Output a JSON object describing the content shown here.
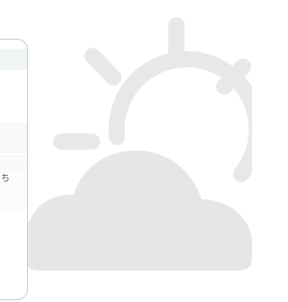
{
  "background": {
    "illustration": "partly-cloudy-icon",
    "color": "#e6e6e6"
  },
  "panel": {
    "glyph": "ち"
  }
}
